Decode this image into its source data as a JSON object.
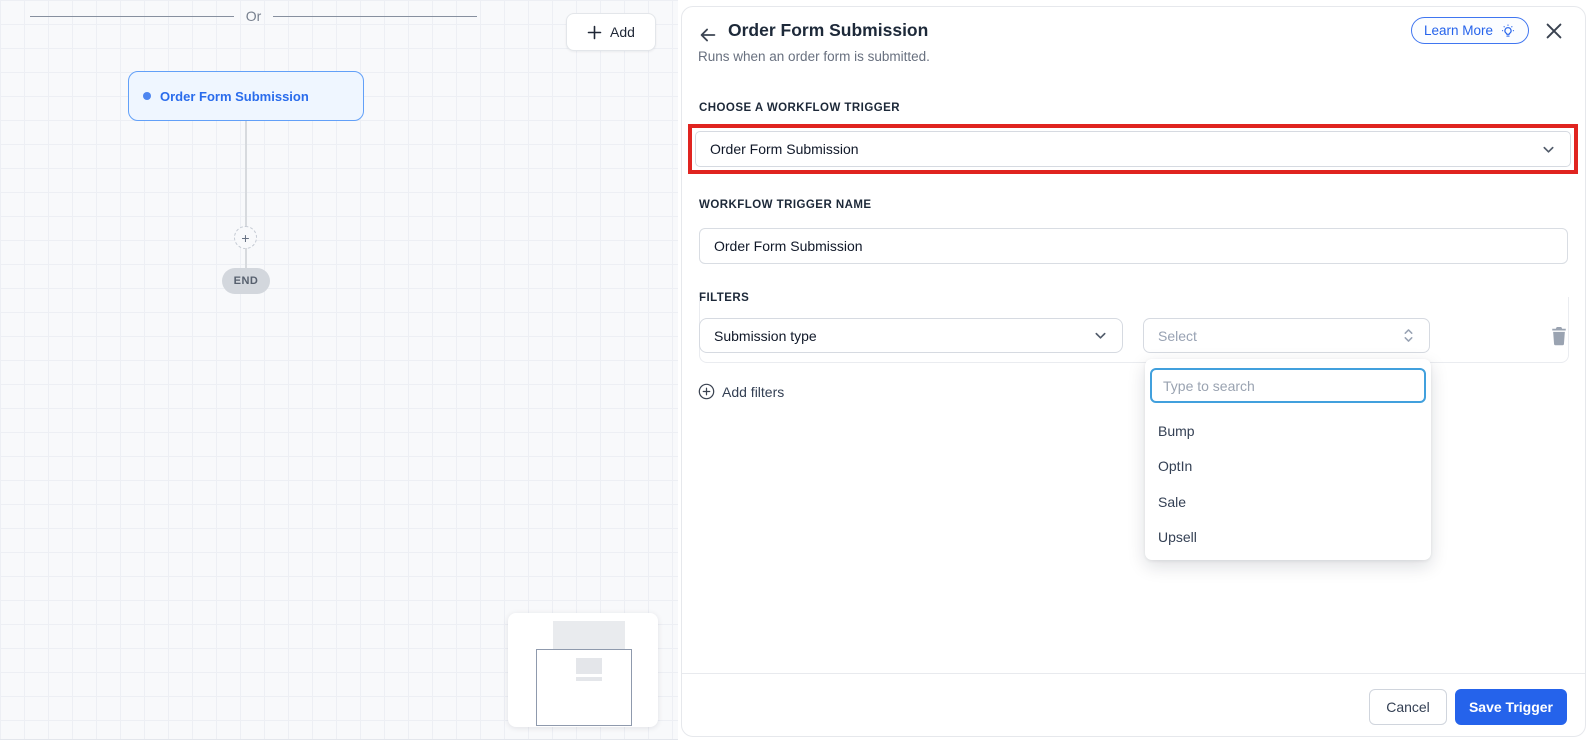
{
  "canvas": {
    "or_label": "Or",
    "add_button_label": "Add",
    "node": {
      "title": "Order Form Submission"
    },
    "plus_label": "+",
    "end_label": "END"
  },
  "drawer": {
    "title": "Order Form Submission",
    "subtitle": "Runs when an order form is submitted.",
    "learn_more_label": "Learn More",
    "trigger_section": {
      "label": "CHOOSE A WORKFLOW TRIGGER",
      "value": "Order Form Submission"
    },
    "name_section": {
      "label": "WORKFLOW TRIGGER NAME",
      "value": "Order Form Submission"
    },
    "filters_section": {
      "label": "FILTERS",
      "field_value": "Submission type",
      "value_placeholder": "Select",
      "add_filters_label": "Add filters",
      "popover": {
        "search_placeholder": "Type to search",
        "options": [
          "Bump",
          "OptIn",
          "Sale",
          "Upsell"
        ]
      }
    },
    "footer": {
      "cancel_label": "Cancel",
      "save_label": "Save Trigger"
    }
  },
  "colors": {
    "accent_blue": "#2563eb",
    "node_border_blue": "#62a0f8",
    "node_bg": "#eff6ff",
    "highlight_red": "#e02420",
    "search_focus_blue": "#41a0dd",
    "canvas_bg": "#f8f9fb"
  }
}
